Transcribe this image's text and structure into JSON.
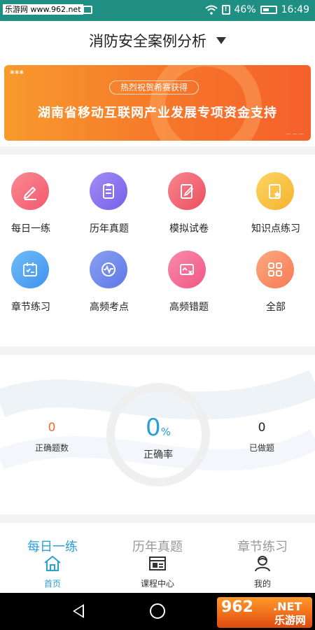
{
  "status_bar": {
    "watermark": "乐游网 www.962.net",
    "battery": "46%",
    "time": "16:49"
  },
  "header": {
    "title": "消防安全案例分析"
  },
  "banner": {
    "pill": "热烈祝贺希赛获得",
    "headline": "湖南省移动互联网产业发展专项资金支持"
  },
  "features": [
    {
      "label": "每日一练",
      "icon": "pencil-icon",
      "color": "#f6687a"
    },
    {
      "label": "历年真题",
      "icon": "clipboard-icon",
      "color": "#8b72f0"
    },
    {
      "label": "模拟试卷",
      "icon": "edit-paper-icon",
      "color": "#f0626e"
    },
    {
      "label": "知识点练习",
      "icon": "star-doc-icon",
      "color": "#f9c241"
    },
    {
      "label": "章节练习",
      "icon": "calendar-check-icon",
      "color": "#4aa3f5"
    },
    {
      "label": "高频考点",
      "icon": "pulse-icon",
      "color": "#6a86ec"
    },
    {
      "label": "高频错题",
      "icon": "error-card-icon",
      "color": "#f56e96"
    },
    {
      "label": "全部",
      "icon": "grid-icon",
      "color": "#f98c62"
    }
  ],
  "stats": {
    "correct_count": "0",
    "correct_count_label": "正确题数",
    "rate_value": "0",
    "rate_unit": "%",
    "rate_label": "正确率",
    "done_count": "0",
    "done_label": "已做题"
  },
  "tabs": [
    "每日一练",
    "历年真题",
    "章节练习"
  ],
  "nav": [
    {
      "label": "首页",
      "icon": "home-icon"
    },
    {
      "label": "课程中心",
      "icon": "course-icon"
    },
    {
      "label": "我的",
      "icon": "user-icon"
    }
  ],
  "system_nav": {
    "brand_number": "962",
    "brand_suffix": ".NET",
    "brand_name": "乐游网"
  },
  "colors": {
    "accent": "#2a9fd6",
    "status_bar": "#1f8f83",
    "banner": "#f6762a",
    "correct_count": "#f56a2a",
    "rate": "#2a9fd6"
  }
}
